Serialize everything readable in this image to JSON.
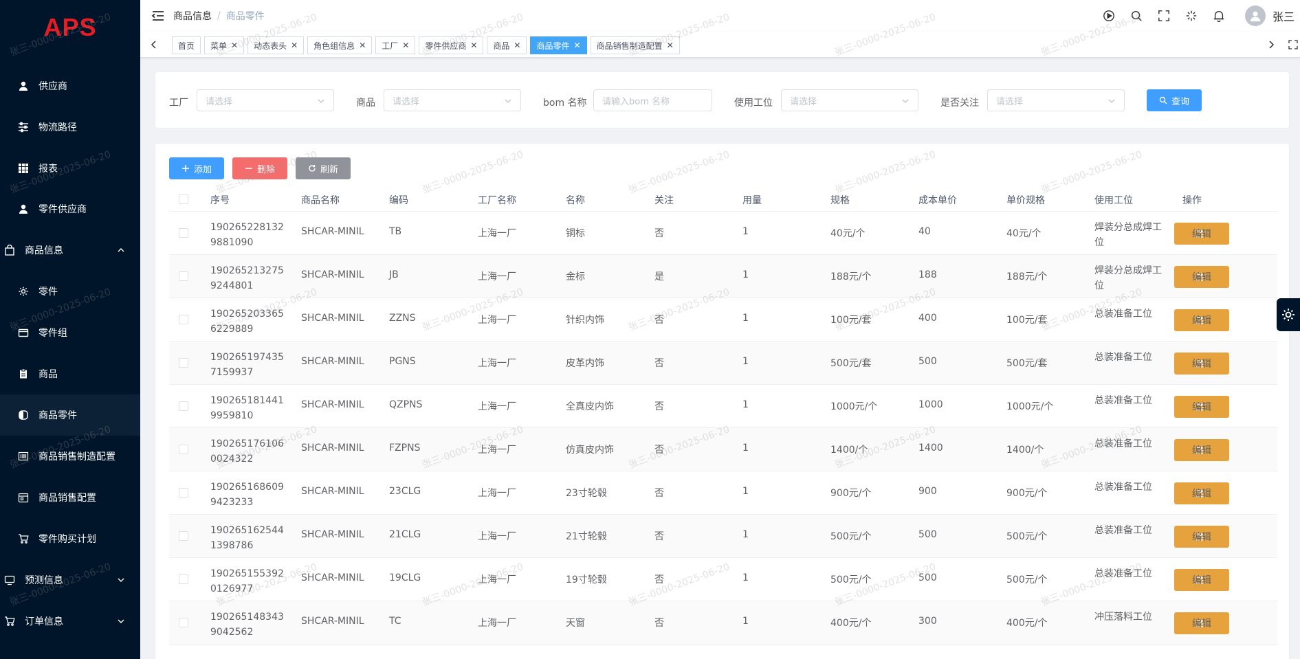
{
  "app": {
    "logo": "APS"
  },
  "sidebar": {
    "items": [
      {
        "label": "供应商",
        "icon": "user-icon"
      },
      {
        "label": "物流路径",
        "icon": "sliders-icon"
      },
      {
        "label": "报表",
        "icon": "grid-icon"
      },
      {
        "label": "零件供应商",
        "icon": "user-icon"
      },
      {
        "label": "商品信息",
        "icon": "bag-icon"
      },
      {
        "label": "零件",
        "icon": "gear-icon"
      },
      {
        "label": "零件组",
        "icon": "wallet-icon"
      },
      {
        "label": "商品",
        "icon": "clipboard-icon"
      },
      {
        "label": "商品零件",
        "icon": "switch-icon"
      },
      {
        "label": "商品销售制造配置",
        "icon": "barcode-icon"
      },
      {
        "label": "商品销售配置",
        "icon": "calendar-icon"
      },
      {
        "label": "零件购买计划",
        "icon": "cart-icon"
      },
      {
        "label": "预测信息",
        "icon": "monitor-icon"
      },
      {
        "label": "订单信息",
        "icon": "cart-icon"
      }
    ]
  },
  "header": {
    "breadcrumb": [
      "商品信息",
      "商品零件"
    ],
    "separator": "/",
    "username": "张三"
  },
  "tags": [
    {
      "label": "首页",
      "closable": false
    },
    {
      "label": "菜单",
      "closable": true
    },
    {
      "label": "动态表头",
      "closable": true
    },
    {
      "label": "角色组信息",
      "closable": true
    },
    {
      "label": "工厂",
      "closable": true
    },
    {
      "label": "零件供应商",
      "closable": true
    },
    {
      "label": "商品",
      "closable": true
    },
    {
      "label": "商品零件",
      "closable": true,
      "active": true
    },
    {
      "label": "商品销售制造配置",
      "closable": true
    }
  ],
  "search": {
    "factory_label": "工厂",
    "factory_placeholder": "请选择",
    "goods_label": "商品",
    "goods_placeholder": "请选择",
    "bom_label": "bom 名称",
    "bom_placeholder": "请输入bom 名称",
    "station_label": "使用工位",
    "station_placeholder": "请选择",
    "follow_label": "是否关注",
    "follow_placeholder": "请选择",
    "query_label": "查询"
  },
  "toolbar": {
    "add_label": "添加",
    "delete_label": "删除",
    "refresh_label": "刷新"
  },
  "table": {
    "columns": [
      "序号",
      "商品名称",
      "编码",
      "工厂名称",
      "名称",
      "关注",
      "用量",
      "规格",
      "成本单价",
      "单价规格",
      "使用工位",
      "操作"
    ],
    "edit_label": "编辑",
    "rows": [
      [
        "1902652281329881090",
        "SHCAR-MINIL",
        "TB",
        "上海一厂",
        "铜标",
        "否",
        "1",
        "40元/个",
        "40",
        "40元/个",
        "焊装分总成焊工位"
      ],
      [
        "1902652132759244801",
        "SHCAR-MINIL",
        "JB",
        "上海一厂",
        "金标",
        "是",
        "1",
        "188元/个",
        "188",
        "188元/个",
        "焊装分总成焊工位"
      ],
      [
        "1902652033656229889",
        "SHCAR-MINIL",
        "ZZNS",
        "上海一厂",
        "针织内饰",
        "否",
        "1",
        "100元/套",
        "400",
        "100元/套",
        "总装准备工位"
      ],
      [
        "1902651974357159937",
        "SHCAR-MINIL",
        "PGNS",
        "上海一厂",
        "皮革内饰",
        "否",
        "1",
        "500元/套",
        "500",
        "500元/套",
        "总装准备工位"
      ],
      [
        "1902651814419959810",
        "SHCAR-MINIL",
        "QZPNS",
        "上海一厂",
        "全真皮内饰",
        "否",
        "1",
        "1000元/个",
        "1000",
        "1000元/个",
        "总装准备工位"
      ],
      [
        "1902651761060024322",
        "SHCAR-MINIL",
        "FZPNS",
        "上海一厂",
        "仿真皮内饰",
        "否",
        "1",
        "1400/个",
        "1400",
        "1400/个",
        "总装准备工位"
      ],
      [
        "1902651686099423233",
        "SHCAR-MINIL",
        "23CLG",
        "上海一厂",
        "23寸轮毂",
        "否",
        "1",
        "900元/个",
        "900",
        "900元/个",
        "总装准备工位"
      ],
      [
        "1902651625441398786",
        "SHCAR-MINIL",
        "21CLG",
        "上海一厂",
        "21寸轮毂",
        "否",
        "1",
        "500元/个",
        "500",
        "500元/个",
        "总装准备工位"
      ],
      [
        "1902651553920126977",
        "SHCAR-MINIL",
        "19CLG",
        "上海一厂",
        "19寸轮毂",
        "否",
        "1",
        "500元/个",
        "500",
        "500元/个",
        "总装准备工位"
      ],
      [
        "1902651483439042562",
        "SHCAR-MINIL",
        "TC",
        "上海一厂",
        "天窗",
        "否",
        "1",
        "400元/个",
        "300",
        "400元/个",
        "冲压落料工位"
      ]
    ]
  },
  "watermark": {
    "text": "张三-0000-2025-06-20"
  },
  "colors": {
    "sidebar_bg": "#001529",
    "primary": "#409eff",
    "danger": "#f56c6c",
    "warning": "#e6a23c",
    "info": "#909399",
    "logo": "#e51c23"
  }
}
